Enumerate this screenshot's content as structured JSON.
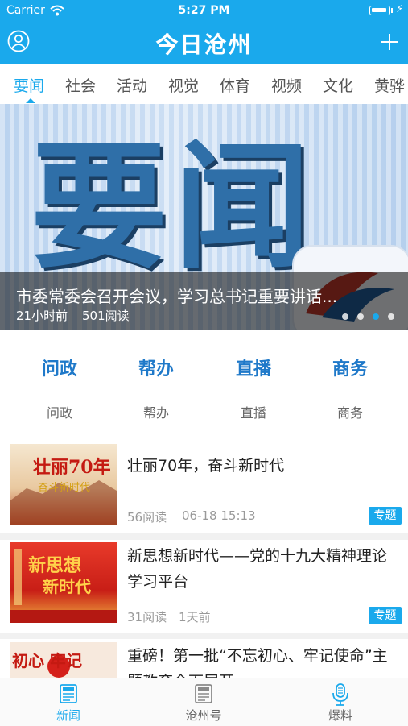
{
  "status_bar": {
    "carrier": "Carrier",
    "time": "5:27 PM"
  },
  "header": {
    "title": "今日沧州",
    "left_icon": "user-icon",
    "right_icon": "plus-icon"
  },
  "tabs": [
    {
      "label": "要闻",
      "active": true
    },
    {
      "label": "社会"
    },
    {
      "label": "活动"
    },
    {
      "label": "视觉"
    },
    {
      "label": "体育"
    },
    {
      "label": "视频"
    },
    {
      "label": "文化"
    },
    {
      "label": "黄骅"
    }
  ],
  "banner": {
    "image_text": "要闻",
    "caption": "市委常委会召开会议，学习总书记重要讲话...",
    "time": "21小时前",
    "reads": "501阅读",
    "page_count": 4,
    "active_page": 3
  },
  "services": [
    {
      "title": "问政",
      "label": "问政"
    },
    {
      "title": "帮办",
      "label": "帮办"
    },
    {
      "title": "直播",
      "label": "直播"
    },
    {
      "title": "商务",
      "label": "商务"
    }
  ],
  "news": [
    {
      "title": "壮丽70年，奋斗新时代",
      "reads": "56阅读",
      "time": "06-18 15:13",
      "badge": "专题",
      "thumb_text": "壮丽70年",
      "thumb_sub": "奋斗新时代"
    },
    {
      "title": "新思想新时代——党的十九大精神理论学习平台",
      "reads": "31阅读",
      "time": "1天前",
      "badge": "专题",
      "thumb_text": "新思想",
      "thumb_sub": "新时代"
    },
    {
      "title": "重磅！第一批“不忘初心、牢记使命”主题教育全面展开",
      "thumb_text": "初心 牢记"
    }
  ],
  "tabbar": [
    {
      "label": "新闻",
      "icon": "newspaper-icon",
      "active": true
    },
    {
      "label": "沧州号",
      "icon": "newspaper-icon"
    },
    {
      "label": "爆料",
      "icon": "microphone-icon"
    }
  ],
  "colors": {
    "primary": "#1aa9ec",
    "service_title": "#1f79c9",
    "meta_gray": "#999999"
  }
}
